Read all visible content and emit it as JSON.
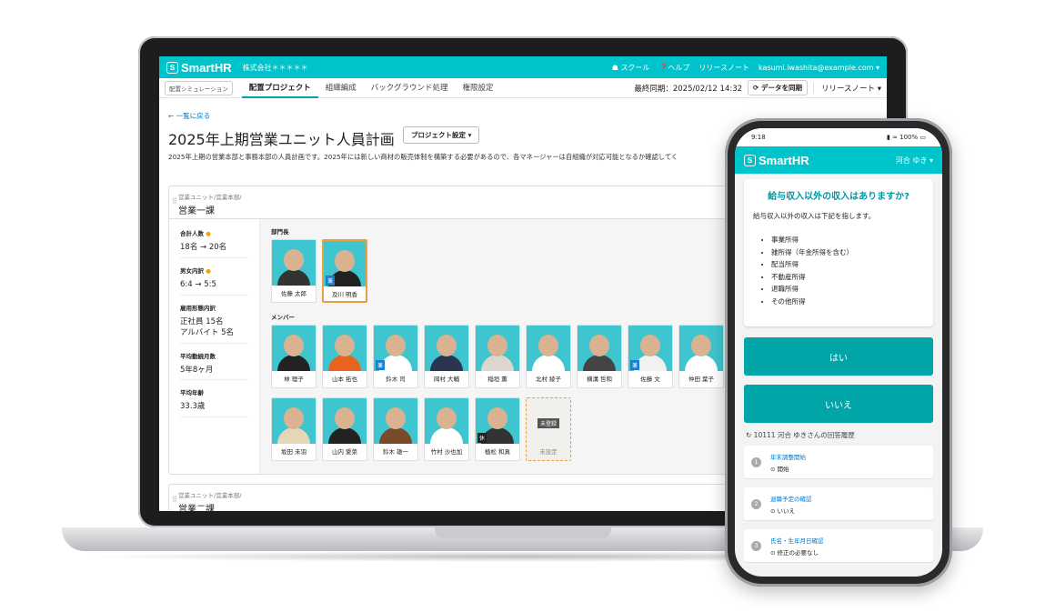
{
  "laptop": {
    "header": {
      "logo": "SmartHR",
      "company": "株式会社＊＊＊＊＊",
      "school": "スクール",
      "help": "ヘルプ",
      "release_notes": "リリースノート",
      "user_email": "kasumi.iwashita@example.com"
    },
    "tabs": {
      "chip": "配置シミュレーション",
      "items": [
        "配置プロジェクト",
        "組織編成",
        "バックグラウンド処理",
        "権限設定"
      ],
      "last_sync": "最終同期：2025/02/12 14:32",
      "sync_button": "データを同期",
      "release_notes": "リリースノート"
    },
    "back_link": "← 一覧に戻る",
    "title": "2025年上期営業ユニット人員計画",
    "project_settings": "プロジェクト設定 ▾",
    "description": "2025年上期の営業本部と事務本部の人員計画です。2025年には新しい商材の販売体制を構築する必要があるので、各マネージャーは自組織が対応可能となるか確認してく",
    "unit1": {
      "path": "営業ユニット/営業本部/",
      "name": "営業一課",
      "stats": [
        {
          "label": "合計人数",
          "value": "18名 → 20名"
        },
        {
          "label": "男女内訳",
          "value": "6:4 → 5:5"
        },
        {
          "label": "雇用形態内訳",
          "value": "正社員 15名\nアルバイト 5名"
        },
        {
          "label": "平均勤続月数",
          "value": "5年8ヶ月"
        },
        {
          "label": "平均年齢",
          "value": "33.3歳"
        }
      ],
      "manager_label": "部門長",
      "managers": [
        "佐藤 太郎",
        "及川 明香"
      ],
      "member_label": "メンバー",
      "members_row1": [
        "林 理子",
        "山本 拓也",
        "鈴木 司",
        "岡村 大輔",
        "稲垣 薫",
        "北村 綾子",
        "横溝 哲和",
        "佐藤 文",
        "仲田 葉子"
      ],
      "members_row2": [
        "坂田 未羽",
        "山内 愛菜",
        "鈴木 雄一",
        "竹村 沙也加",
        "植松 和真",
        "未設定"
      ],
      "badge_concurrent": "兼",
      "badge_rest": "休",
      "unregistered": "未登録"
    },
    "unit2": {
      "path": "営業ユニット/営業本部/",
      "name": "営業二課"
    }
  },
  "phone": {
    "time": "9:18",
    "battery": "100%",
    "logo": "SmartHR",
    "user": "河合 ゆき ▾",
    "question": "給与収入以外の収入はありますか?",
    "body": "給与収入以外の収入は下記を指します。",
    "list": [
      "事業所得",
      "雑所得（年金所得を含む）",
      "配当所得",
      "不動産所得",
      "退職所得",
      "その他所得"
    ],
    "yes": "はい",
    "no": "いいえ",
    "history_title": "10111 河合 ゆきさんの回答履歴",
    "history": [
      {
        "n": "1",
        "title": "年末調整開始",
        "answer": "開始"
      },
      {
        "n": "2",
        "title": "退職予定の確認",
        "answer": "いいえ"
      },
      {
        "n": "3",
        "title": "氏名・生年月日確認",
        "answer": "修正の必要なし"
      }
    ]
  }
}
